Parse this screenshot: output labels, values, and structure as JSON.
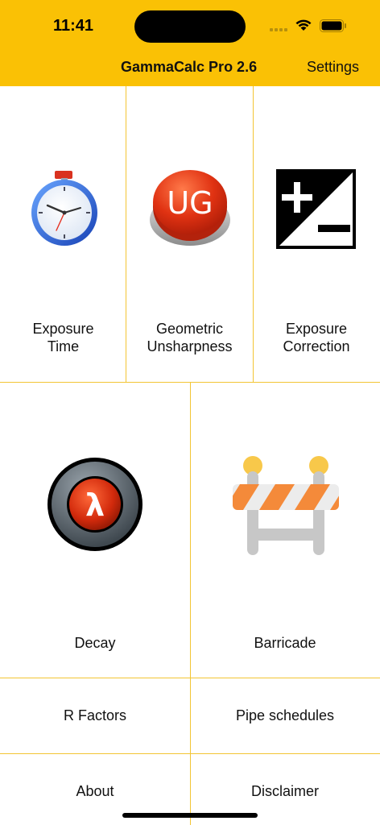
{
  "status_bar": {
    "time": "11:41"
  },
  "nav": {
    "title": "GammaCalc Pro 2.6",
    "settings_label": "Settings"
  },
  "colors": {
    "accent": "#FAC105",
    "divider": "#F3C534"
  },
  "tiles": {
    "exposure_time": {
      "line1": "Exposure",
      "line2": "Time",
      "icon": "stopwatch-icon"
    },
    "geometric_unsharpness": {
      "line1": "Geometric",
      "line2": "Unsharpness",
      "icon": "ug-button-icon",
      "icon_text": "UG"
    },
    "exposure_correction": {
      "line1": "Exposure",
      "line2": "Correction",
      "icon": "plus-minus-icon"
    },
    "decay": {
      "label": "Decay",
      "icon": "lambda-icon",
      "icon_text": "λ"
    },
    "barricade": {
      "label": "Barricade",
      "icon": "barricade-icon"
    },
    "r_factors": {
      "label": "R Factors"
    },
    "pipe_schedules": {
      "label": "Pipe schedules"
    },
    "about": {
      "label": "About"
    },
    "disclaimer": {
      "label": "Disclaimer"
    }
  }
}
